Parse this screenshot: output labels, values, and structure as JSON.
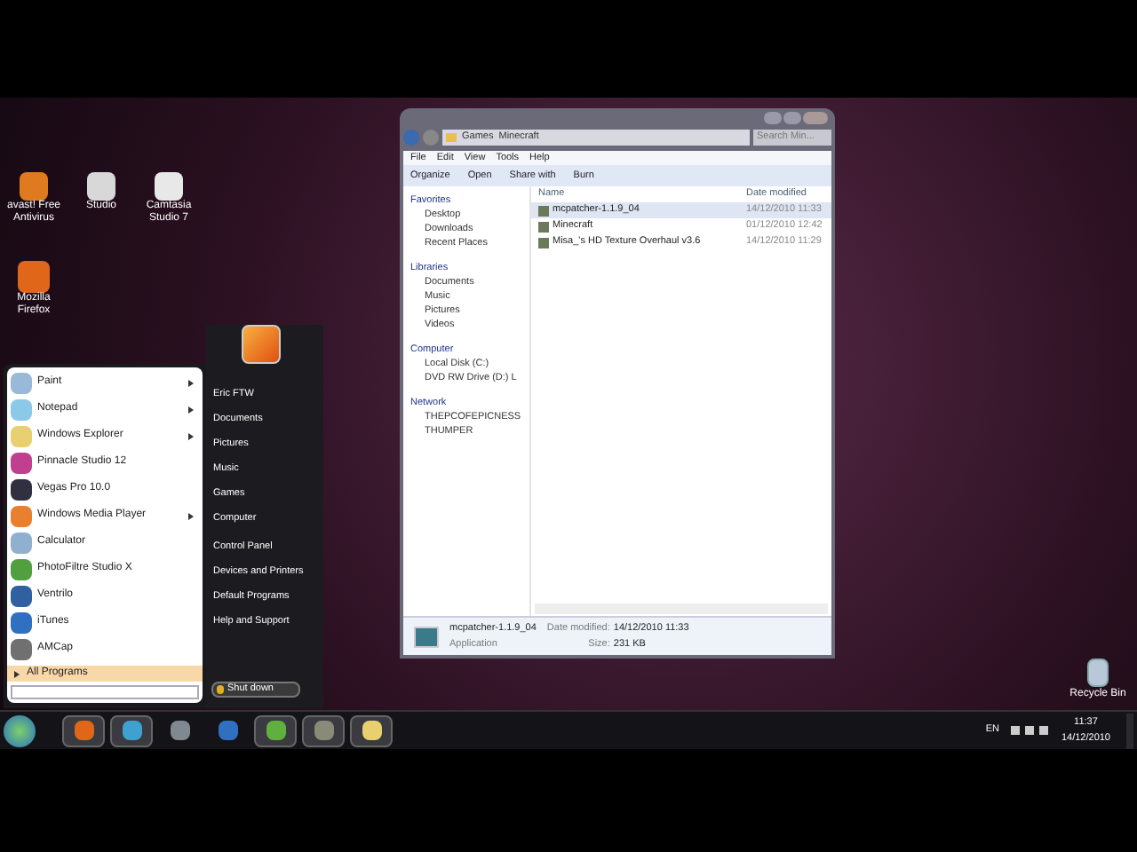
{
  "desktop_icons": [
    {
      "label": "avast! Free Antivirus",
      "color": "#e07a20"
    },
    {
      "label": "Studio",
      "color": "#d8d8d8"
    },
    {
      "label": "Camtasia Studio 7",
      "color": "#e8e8e8"
    },
    {
      "label": "Mozilla Firefox",
      "color": "#e0661a"
    }
  ],
  "recycle_bin": {
    "label": "Recycle Bin"
  },
  "start_menu": {
    "programs": [
      {
        "label": "Paint",
        "submenu": true,
        "color": "#9ab8d8"
      },
      {
        "label": "Notepad",
        "submenu": true,
        "color": "#8cc8e8"
      },
      {
        "label": "Windows Explorer",
        "submenu": true,
        "color": "#e8d070"
      },
      {
        "label": "Pinnacle Studio 12",
        "submenu": false,
        "color": "#c04090"
      },
      {
        "label": "Vegas Pro 10.0",
        "submenu": false,
        "color": "#303040"
      },
      {
        "label": "Windows Media Player",
        "submenu": true,
        "color": "#e88030"
      },
      {
        "label": "Calculator",
        "submenu": false,
        "color": "#90b0d0"
      },
      {
        "label": "PhotoFiltre Studio X",
        "submenu": false,
        "color": "#50a040"
      },
      {
        "label": "Ventrilo",
        "submenu": false,
        "color": "#3060a0"
      },
      {
        "label": "iTunes",
        "submenu": false,
        "color": "#3070c0"
      },
      {
        "label": "AMCap",
        "submenu": false,
        "color": "#707070"
      }
    ],
    "all_programs": "All Programs",
    "places": [
      "Eric FTW",
      "Documents",
      "Pictures",
      "Music",
      "Games",
      "Computer",
      "Control Panel",
      "Devices and Printers",
      "Default Programs",
      "Help and Support"
    ],
    "shut_down": "Shut down"
  },
  "explorer": {
    "breadcrumb": [
      "Games",
      "Minecraft"
    ],
    "search": {
      "placeholder": "Search Min..."
    },
    "menu": [
      "File",
      "Edit",
      "View",
      "Tools",
      "Help"
    ],
    "toolbar": [
      "Organize",
      "Open",
      "Share with",
      "Burn"
    ],
    "nav": [
      {
        "label": "Favorites",
        "children": [
          {
            "label": "Desktop"
          },
          {
            "label": "Downloads"
          },
          {
            "label": "Recent Places"
          }
        ]
      },
      {
        "label": "Libraries",
        "children": [
          {
            "label": "Documents"
          },
          {
            "label": "Music"
          },
          {
            "label": "Pictures"
          },
          {
            "label": "Videos"
          }
        ]
      },
      {
        "label": "Computer",
        "children": [
          {
            "label": "Local Disk (C:)"
          },
          {
            "label": "DVD RW Drive (D:) L"
          }
        ]
      },
      {
        "label": "Network",
        "children": [
          {
            "label": "THEPCOFEPICNESS"
          },
          {
            "label": "THUMPER"
          }
        ]
      }
    ],
    "columns": [
      "Name",
      "Date modified"
    ],
    "rows": [
      {
        "name": "mcpatcher-1.1.9_04",
        "date": "14/12/2010 11:33",
        "selected": true
      },
      {
        "name": "Minecraft",
        "date": "01/12/2010 12:42",
        "selected": false
      },
      {
        "name": "Misa_'s HD Texture Overhaul v3.6",
        "date": "14/12/2010 11:29",
        "selected": false
      }
    ],
    "details": {
      "name": "mcpatcher-1.1.9_04",
      "type": "Application",
      "date_label": "Date modified:",
      "date": "14/12/2010 11:33",
      "size_label": "Size:",
      "size": "231 KB"
    }
  },
  "taskbar": {
    "apps": [
      {
        "color": "#e0661a",
        "open": true
      },
      {
        "color": "#40a0d0",
        "open": true
      },
      {
        "color": "#808890",
        "open": false
      },
      {
        "color": "#3070c0",
        "open": false
      },
      {
        "color": "#60b040",
        "open": true
      },
      {
        "color": "#8a8a78",
        "open": true
      },
      {
        "color": "#e8d070",
        "open": true
      }
    ],
    "language": "EN",
    "time": "11:37",
    "date": "14/12/2010"
  }
}
